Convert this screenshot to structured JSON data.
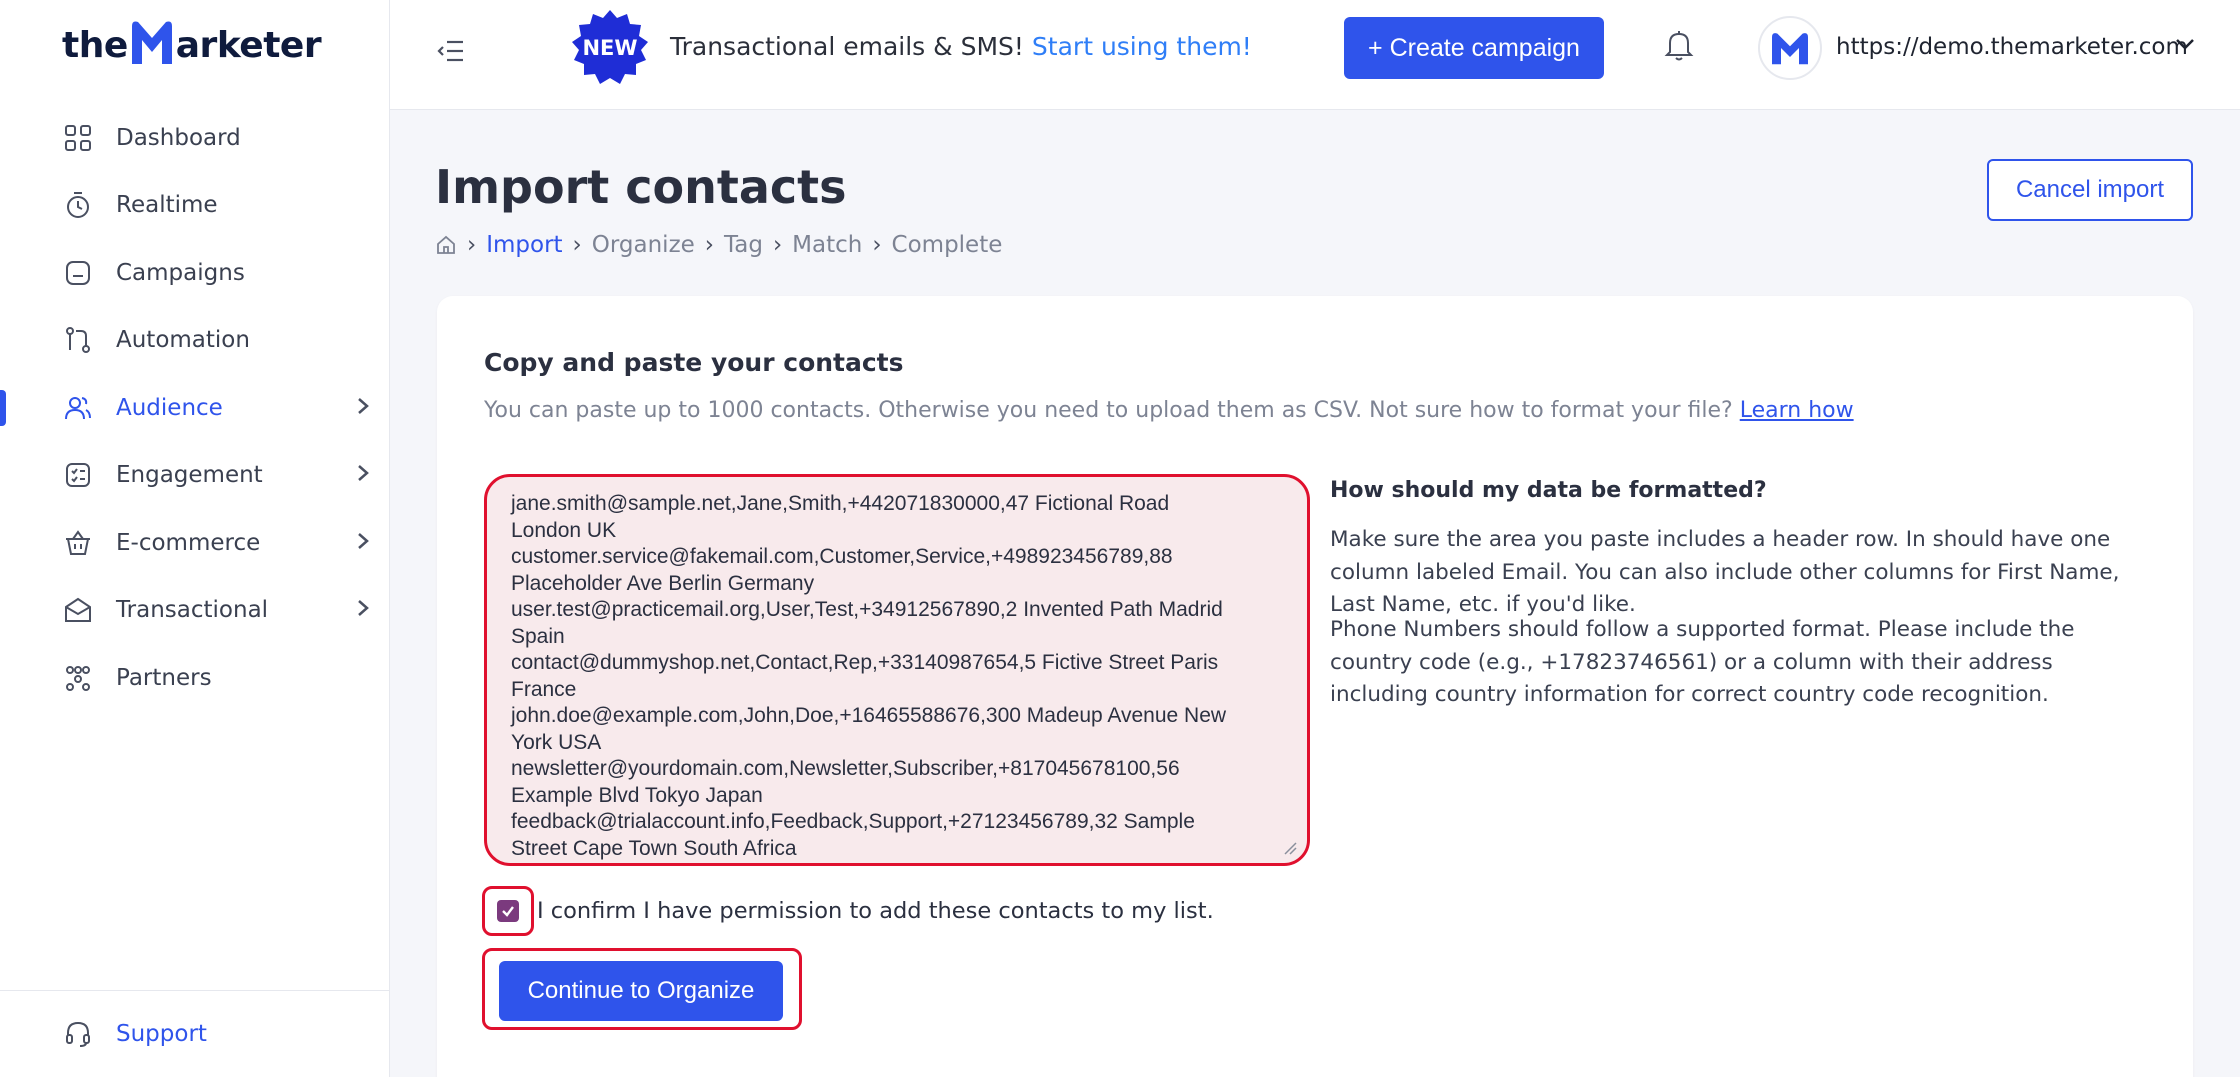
{
  "app": {
    "logo_text_left": "the",
    "logo_text_right": "arketer"
  },
  "sidebar": {
    "items": [
      {
        "label": "Dashboard",
        "icon": "grid-icon",
        "has_chevron": false
      },
      {
        "label": "Realtime",
        "icon": "stopwatch-icon",
        "has_chevron": false
      },
      {
        "label": "Campaigns",
        "icon": "campaigns-icon",
        "has_chevron": false
      },
      {
        "label": "Automation",
        "icon": "automation-icon",
        "has_chevron": false
      },
      {
        "label": "Audience",
        "icon": "users-icon",
        "has_chevron": true,
        "active": true
      },
      {
        "label": "Engagement",
        "icon": "checklist-icon",
        "has_chevron": true
      },
      {
        "label": "E-commerce",
        "icon": "basket-icon",
        "has_chevron": true
      },
      {
        "label": "Transactional",
        "icon": "envelope-icon",
        "has_chevron": true
      },
      {
        "label": "Partners",
        "icon": "partners-icon",
        "has_chevron": false
      }
    ],
    "support_label": "Support"
  },
  "topbar": {
    "badge": "NEW",
    "promo_text": "Transactional emails & SMS!",
    "promo_link": "Start using them!",
    "create_button": "+ Create campaign",
    "account_url": "https://demo.themarketer.com"
  },
  "page": {
    "title": "Import contacts",
    "cancel_button": "Cancel import",
    "breadcrumb": [
      "Import",
      "Organize",
      "Tag",
      "Match",
      "Complete"
    ],
    "breadcrumb_active_index": 0
  },
  "card": {
    "title": "Copy and paste your contacts",
    "subtitle": "You can paste up to 1000 contacts. Otherwise you need to upload them as CSV. Not sure how to format your file?",
    "subtitle_link": "Learn how",
    "paste_value": "jane.smith@sample.net,Jane,Smith,+442071830000,47 Fictional Road\nLondon UK\ncustomer.service@fakemail.com,Customer,Service,+498923456789,88\nPlaceholder Ave Berlin Germany\nuser.test@practicemail.org,User,Test,+34912567890,2 Invented Path Madrid\nSpain\ncontact@dummyshop.net,Contact,Rep,+33140987654,5 Fictive Street Paris\nFrance\njohn.doe@example.com,John,Doe,+16465588676,300 Madeup Avenue New\nYork USA\nnewsletter@yourdomain.com,Newsletter,Subscriber,+817045678100,56\nExample Blvd Tokyo Japan\nfeedback@trialaccount.info,Feedback,Support,+27123456789,32 Sample\nStreet Cape Town South Africa",
    "help_title": "How should my data be formatted?",
    "help_p1": "Make sure the area you paste includes a header row. In should have one column labeled Email. You can also include other columns for First Name, Last Name, etc. if you'd like.",
    "help_p2": "Phone Numbers should follow a supported format. Please include the country code (e.g., +17823746561) or a column with their address including country information for correct country code recognition.",
    "confirm_label": "I confirm I have permission to add these contacts to my list.",
    "confirm_checked": true,
    "continue_button": "Continue to Organize"
  },
  "colors": {
    "primary": "#2f54eb",
    "highlight": "#e0102e",
    "checkbox": "#7b3a7e"
  }
}
